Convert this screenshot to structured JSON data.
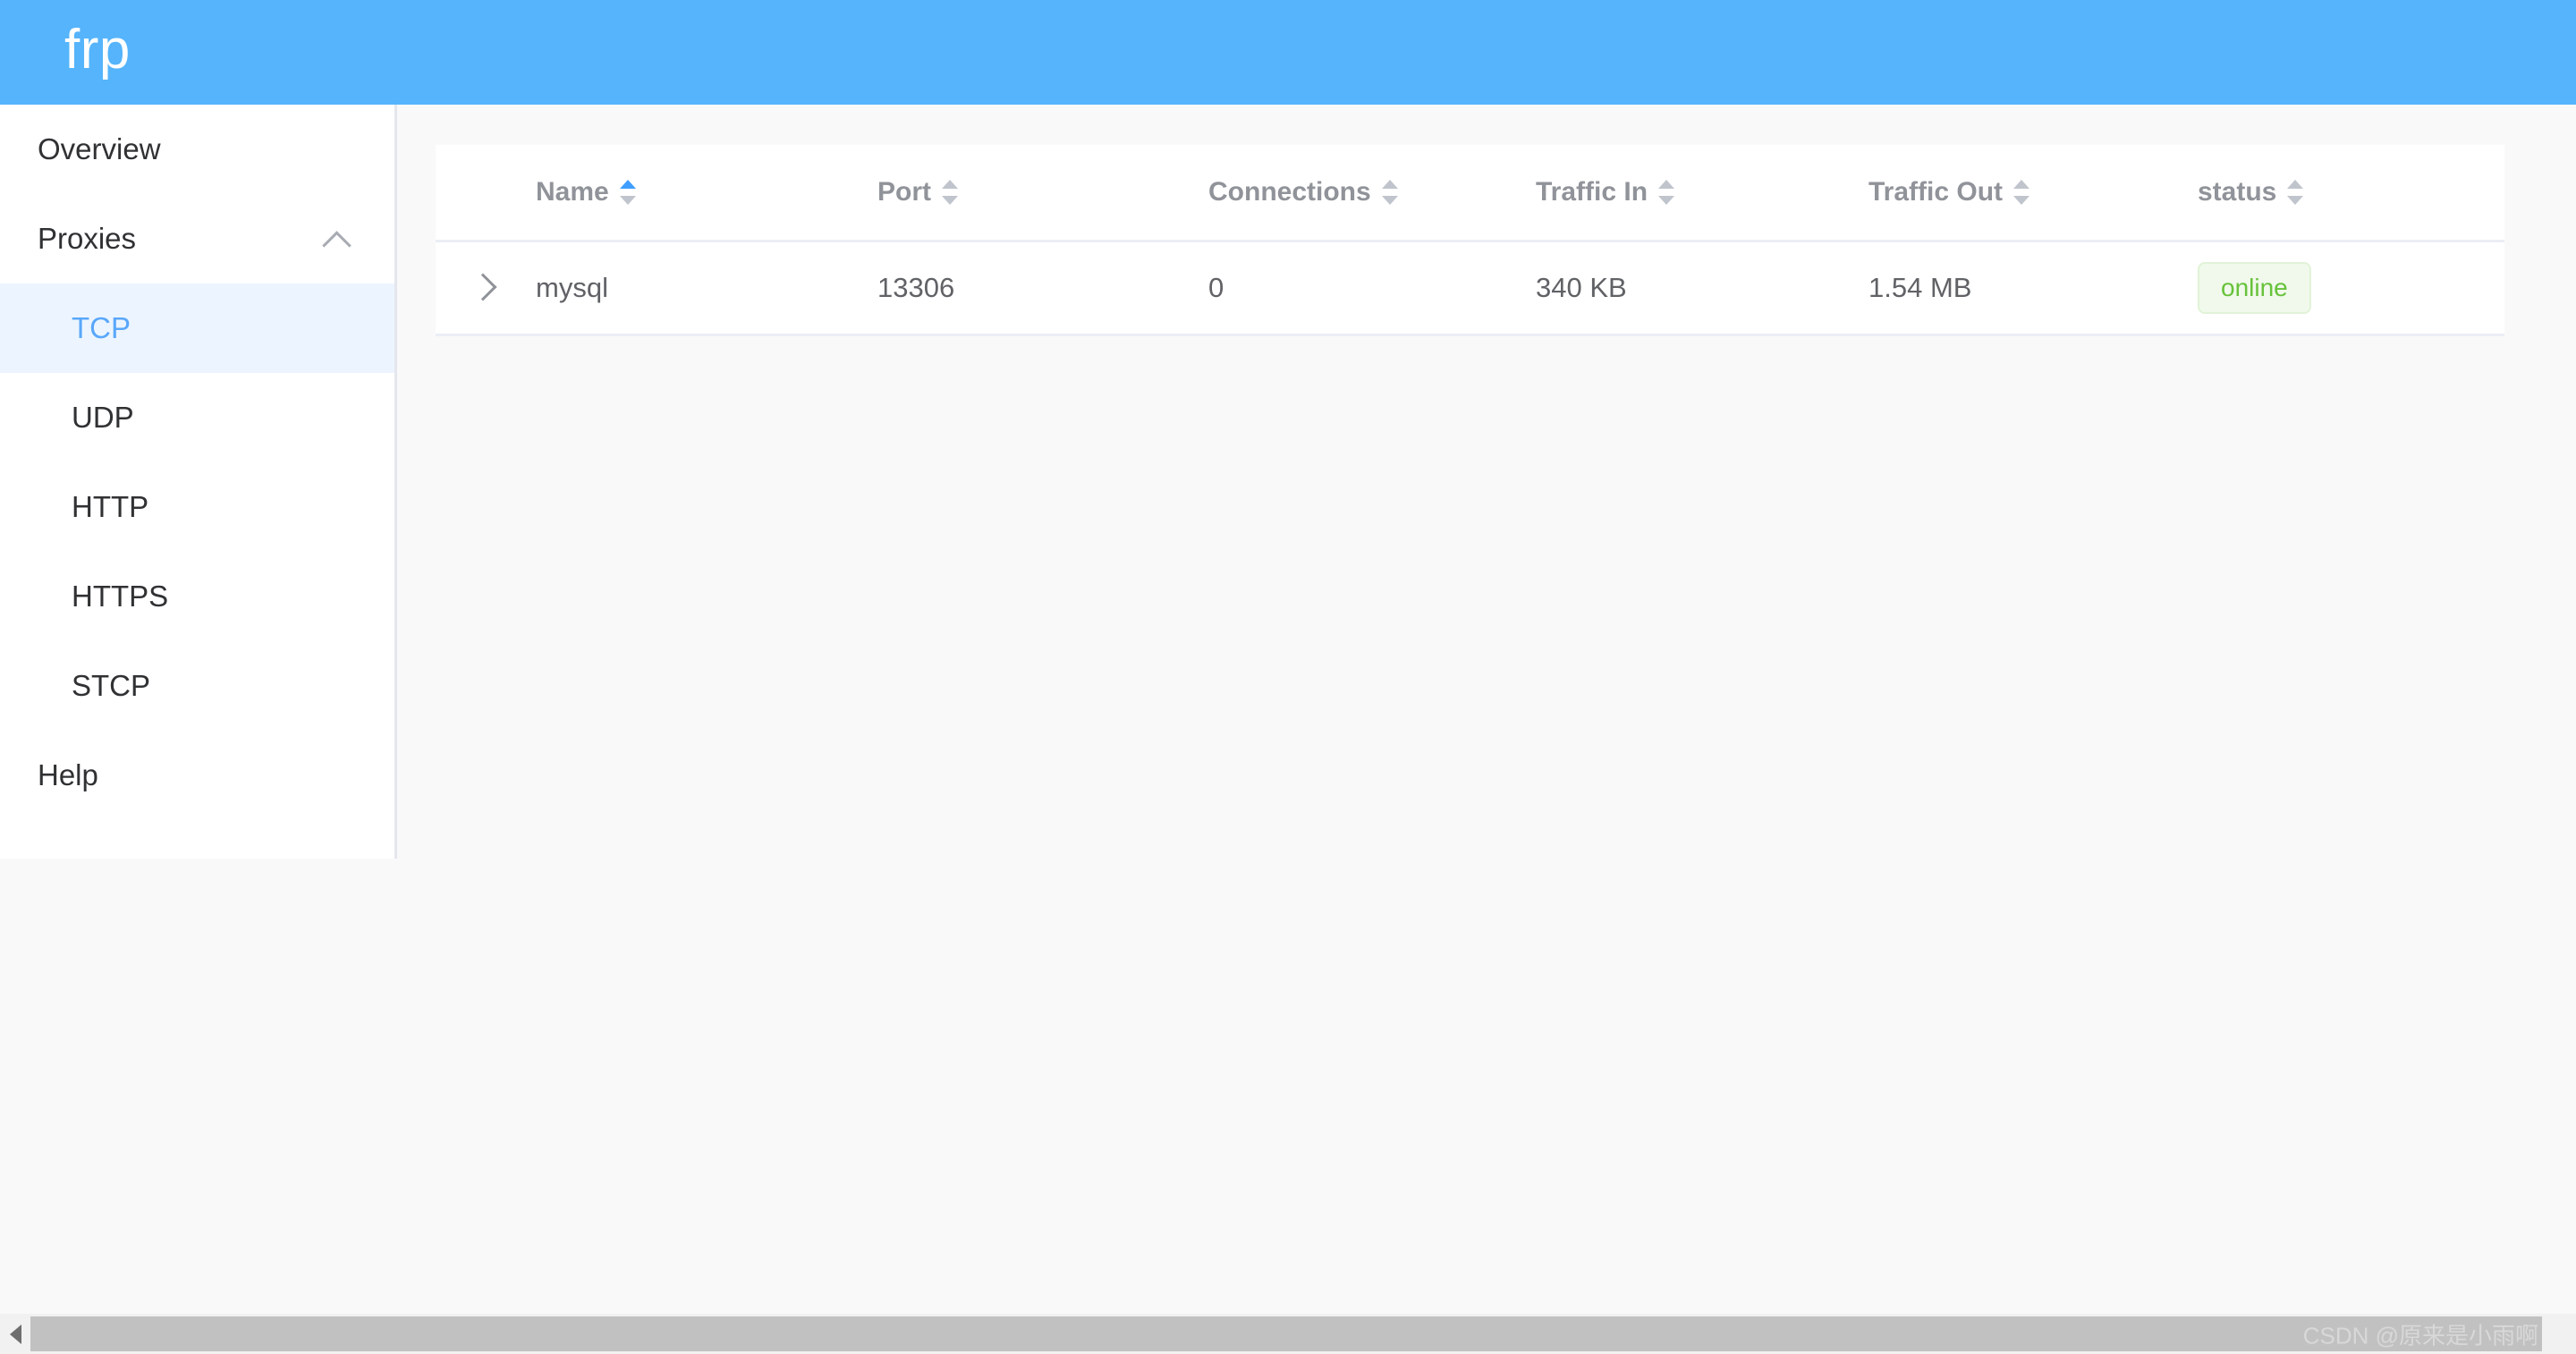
{
  "header": {
    "brand": "frp",
    "brand_bg": "#55b4fb"
  },
  "sidebar": {
    "items": [
      {
        "label": "Overview",
        "level": "top",
        "active": false
      },
      {
        "label": "Proxies",
        "level": "group",
        "active": false,
        "icon": "chevron-up-icon",
        "expanded": true
      },
      {
        "label": "TCP",
        "level": "sub",
        "active": true
      },
      {
        "label": "UDP",
        "level": "sub",
        "active": false
      },
      {
        "label": "HTTP",
        "level": "sub",
        "active": false
      },
      {
        "label": "HTTPS",
        "level": "sub",
        "active": false
      },
      {
        "label": "STCP",
        "level": "sub",
        "active": false
      },
      {
        "label": "Help",
        "level": "top",
        "active": false
      }
    ],
    "active_bg": "#ecf5ff",
    "active_color": "#5aa7fa"
  },
  "table": {
    "columns": [
      {
        "key": "name",
        "label": "Name",
        "sortable": true,
        "sort": "asc"
      },
      {
        "key": "port",
        "label": "Port",
        "sortable": true,
        "sort": "none"
      },
      {
        "key": "connections",
        "label": "Connections",
        "sortable": true,
        "sort": "none"
      },
      {
        "key": "traffic_in",
        "label": "Traffic In",
        "sortable": true,
        "sort": "none"
      },
      {
        "key": "traffic_out",
        "label": "Traffic Out",
        "sortable": true,
        "sort": "none"
      },
      {
        "key": "status",
        "label": "status",
        "sortable": true,
        "sort": "none"
      }
    ],
    "rows": [
      {
        "expand_icon": "chevron-right-icon",
        "name": "mysql",
        "port": "13306",
        "connections": "0",
        "traffic_in": "340 KB",
        "traffic_out": "1.54 MB",
        "status": "online",
        "status_color": "#67c23a",
        "status_bg": "#f0f9eb"
      }
    ]
  },
  "scrollbar": {
    "left_arrow_icon": "triangle-left-icon"
  },
  "watermark": {
    "text": "CSDN @原来是小雨啊"
  }
}
